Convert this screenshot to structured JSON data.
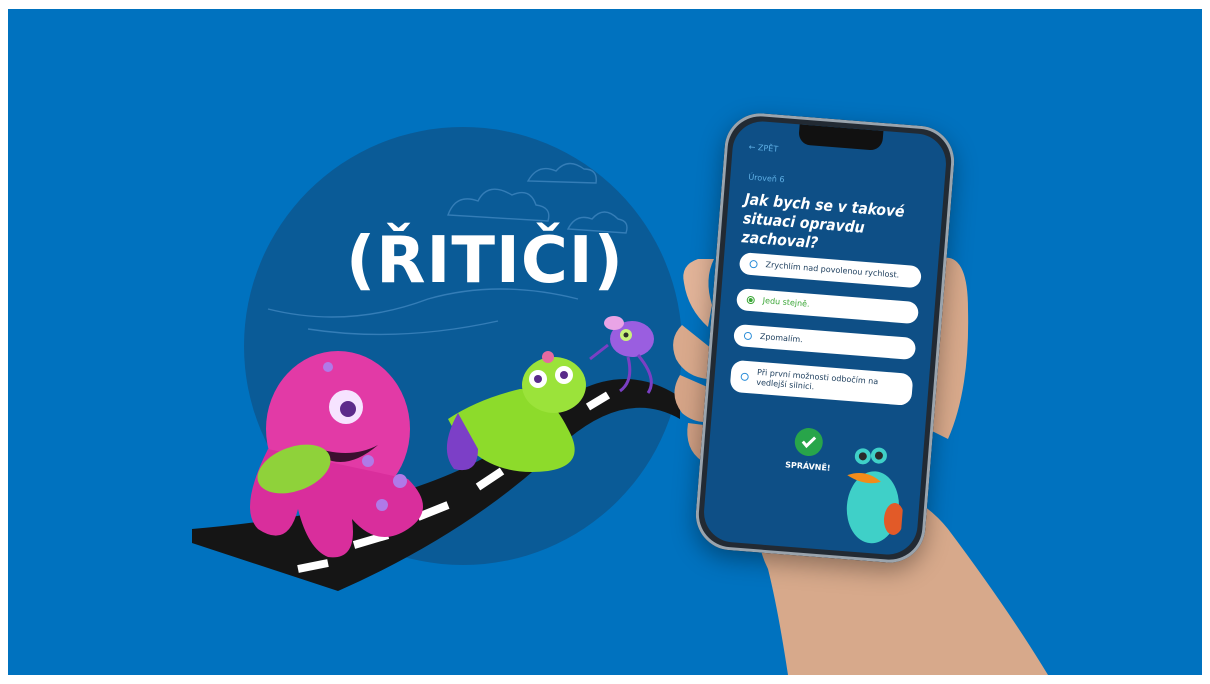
{
  "brand": {
    "logo_text": "(ŘITIČI)"
  },
  "colors": {
    "background": "#0072bf",
    "circle": "#0a5b97",
    "screen": "#0e4f86",
    "correct": "#3aa636"
  },
  "app": {
    "back_label": "← ZPĚT",
    "level_label": "Úroveň 6",
    "question": "Jak bych se v takové situaci opravdu zachoval?",
    "answers": [
      {
        "label": "Zrychlím nad povolenou rychlost.",
        "selected": false
      },
      {
        "label": "Jedu stejně.",
        "selected": true
      },
      {
        "label": "Zpomalím.",
        "selected": false
      },
      {
        "label": "Při první možnosti odbočím na vedlejší silnici.",
        "selected": false
      }
    ],
    "result_icon": "check-icon",
    "result_label": "SPRÁVNĚ!"
  }
}
